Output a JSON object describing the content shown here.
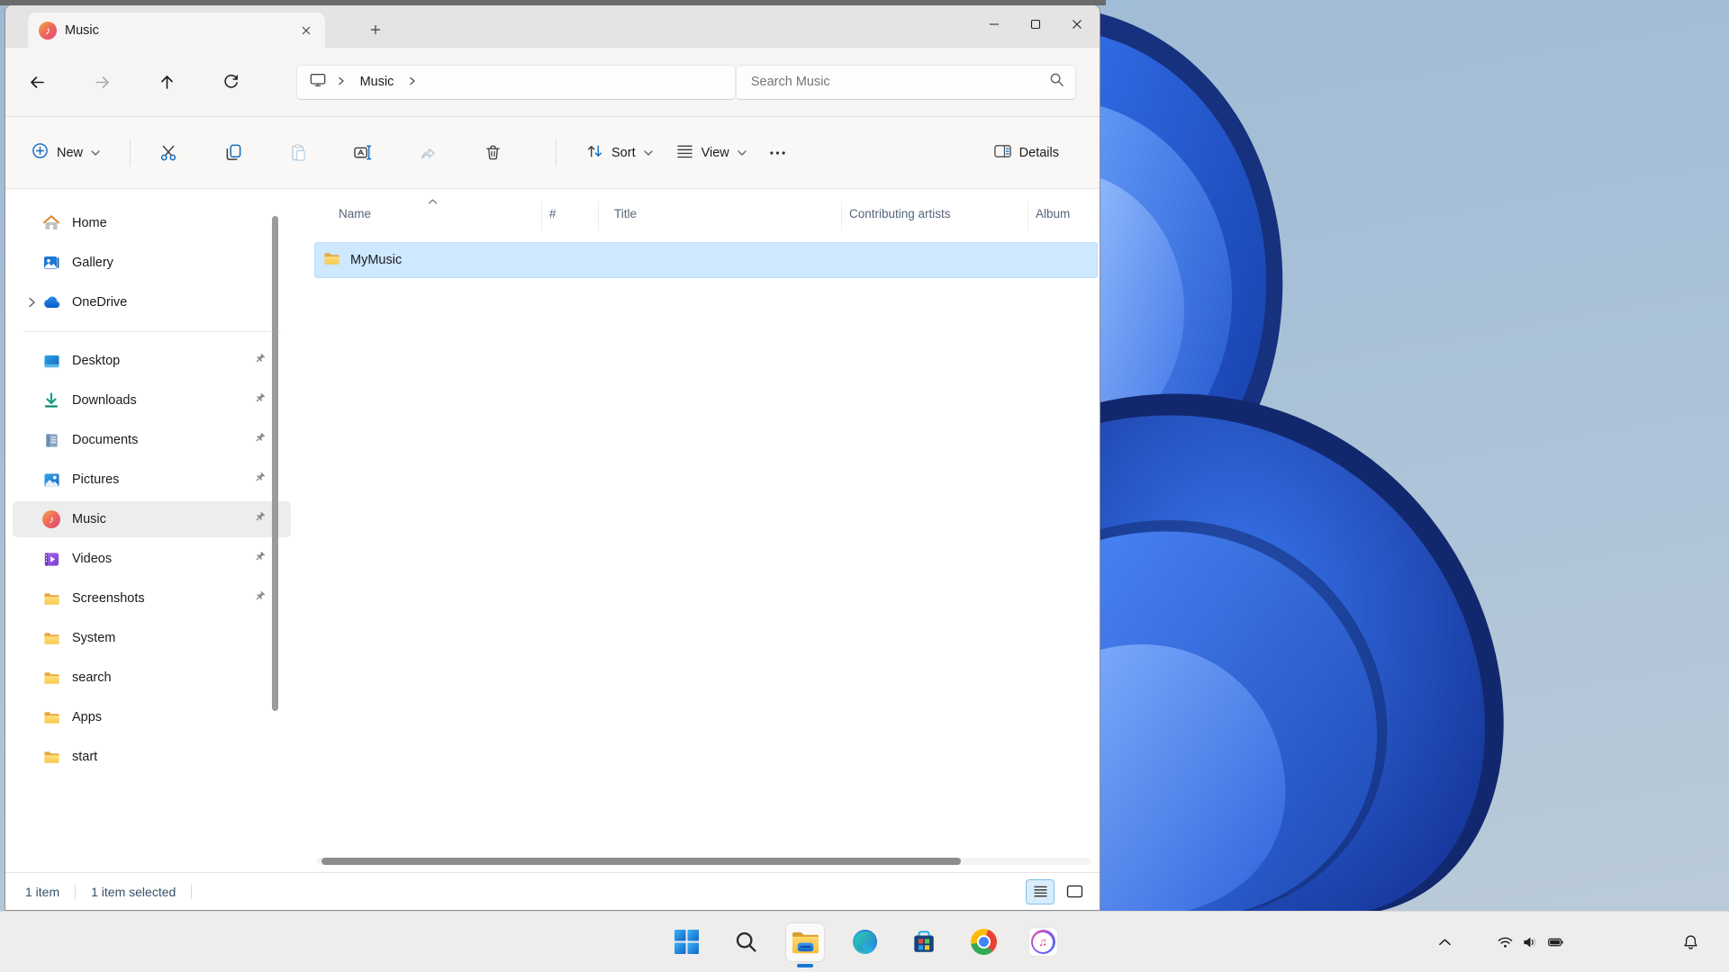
{
  "glyphs": {
    "music_note": "♪",
    "itunes_note": "♫"
  },
  "tab": {
    "title": "Music"
  },
  "nav": {
    "breadcrumb": [
      "Music"
    ],
    "search_placeholder": "Search Music"
  },
  "toolbar": {
    "new_label": "New",
    "sort_label": "Sort",
    "view_label": "View",
    "details_label": "Details"
  },
  "sidebar": {
    "items_top": [
      {
        "label": "Home"
      },
      {
        "label": "Gallery"
      },
      {
        "label": "OneDrive"
      }
    ],
    "items": [
      {
        "label": "Desktop"
      },
      {
        "label": "Downloads"
      },
      {
        "label": "Documents"
      },
      {
        "label": "Pictures"
      },
      {
        "label": "Music"
      },
      {
        "label": "Videos"
      },
      {
        "label": "Screenshots"
      },
      {
        "label": "System"
      },
      {
        "label": "search"
      },
      {
        "label": "Apps"
      },
      {
        "label": "start"
      }
    ]
  },
  "list": {
    "columns": [
      "Name",
      "#",
      "Title",
      "Contributing artists",
      "Album"
    ],
    "rows": [
      {
        "name": "MyMusic"
      }
    ]
  },
  "status": {
    "count": "1 item",
    "selected": "1 item selected"
  },
  "taskbar": {
    "apps": [
      "windows-start",
      "search",
      "file-explorer",
      "edge",
      "microsoft-store",
      "chrome",
      "itunes"
    ],
    "tray": [
      "hidden-icons-chevron",
      "wifi",
      "volume",
      "battery",
      "notifications-bell"
    ]
  },
  "colors": {
    "accent_blue": "#0f6cbd",
    "selection_bg": "#cde8ff",
    "taskbar_bg": "#efedec",
    "petal_blue": "#2f6ae4"
  }
}
